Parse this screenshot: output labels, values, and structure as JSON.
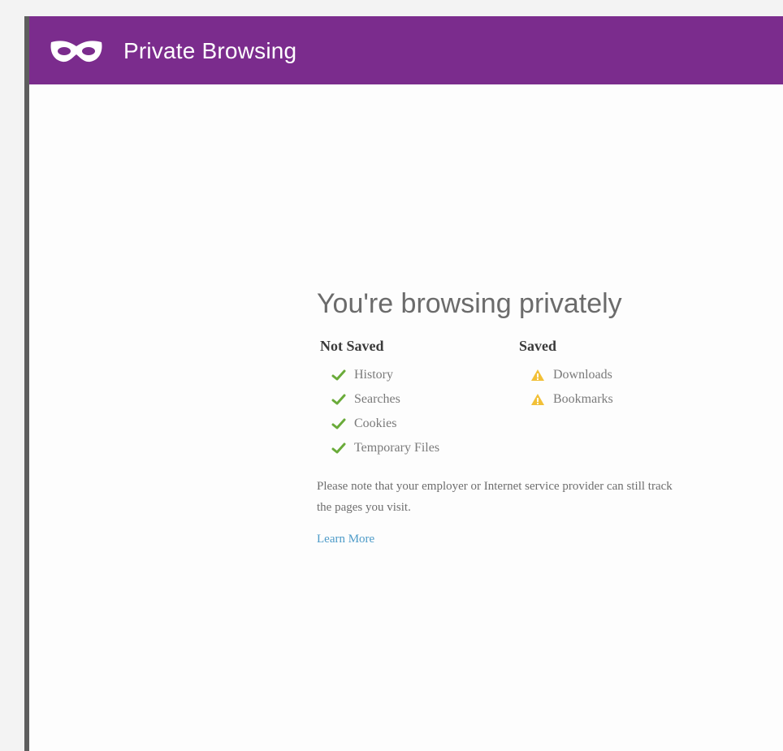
{
  "window": {
    "title": "Private Browsing",
    "accent_color": "#7b2c8d",
    "icon": "mask-icon"
  },
  "content": {
    "heading": "You're browsing privately",
    "not_saved": {
      "title": "Not Saved",
      "items": [
        {
          "label": "History",
          "icon": "check-icon"
        },
        {
          "label": "Searches",
          "icon": "check-icon"
        },
        {
          "label": "Cookies",
          "icon": "check-icon"
        },
        {
          "label": "Temporary Files",
          "icon": "check-icon"
        }
      ]
    },
    "saved": {
      "title": "Saved",
      "items": [
        {
          "label": "Downloads",
          "icon": "warning-icon"
        },
        {
          "label": "Bookmarks",
          "icon": "warning-icon"
        }
      ]
    },
    "note_line1": "Please note that your employer or Internet service provider can still track",
    "note_line2": "the pages you visit.",
    "learn_more": "Learn More"
  },
  "colors": {
    "check": "#6aab3a",
    "warning": "#f2c037",
    "link": "#4d9bc8"
  }
}
